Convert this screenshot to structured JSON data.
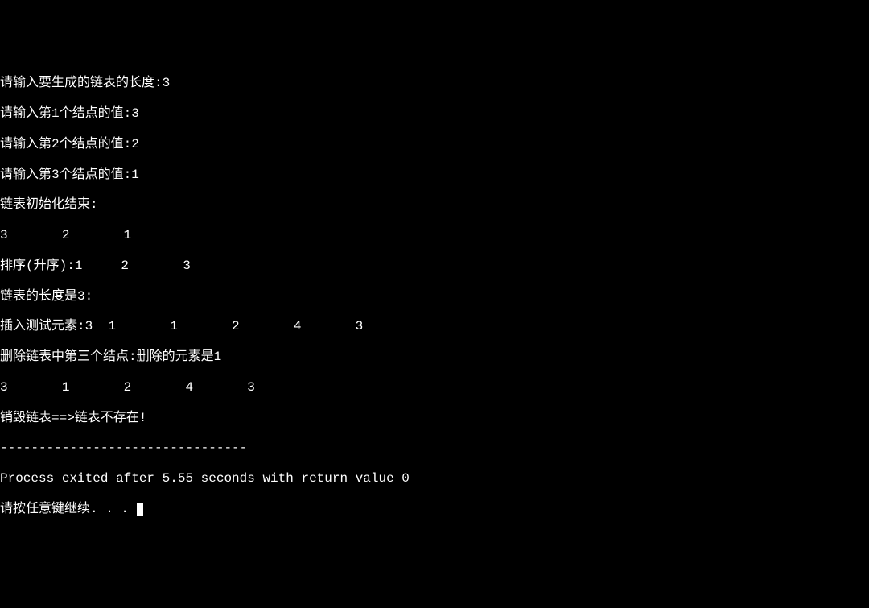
{
  "console": {
    "lines": [
      "请输入要生成的链表的长度:3",
      "请输入第1个结点的值:3",
      "请输入第2个结点的值:2",
      "请输入第3个结点的值:1",
      "链表初始化结束:",
      "3       2       1",
      "排序(升序):1     2       3",
      "链表的长度是3:",
      "插入测试元素:3  1       1       2       4       3",
      "删除链表中第三个结点:删除的元素是1",
      "3       1       2       4       3",
      "销毁链表==>链表不存在!",
      "--------------------------------",
      "Process exited after 5.55 seconds with return value 0",
      "请按任意键继续. . . "
    ]
  }
}
